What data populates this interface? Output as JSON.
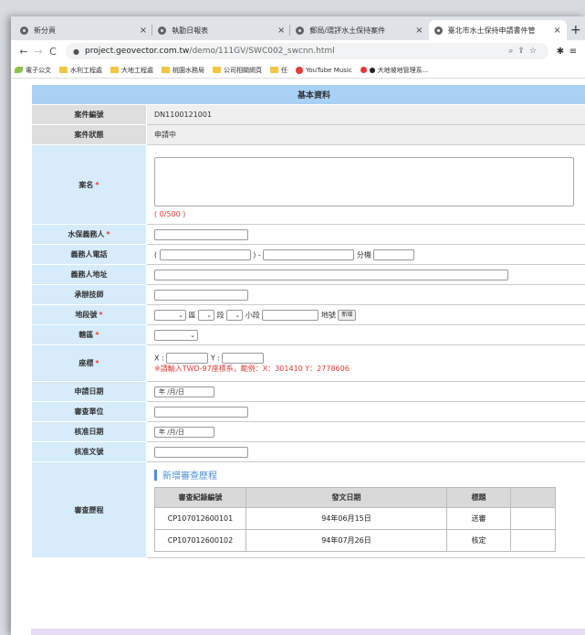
{
  "browser": {
    "tabs": [
      {
        "title": "新分頁",
        "active": false
      },
      {
        "title": "執勤日報表",
        "active": false
      },
      {
        "title": "郵局/環評水土保持案件",
        "active": false
      },
      {
        "title": "臺北市水土保持申請書件管",
        "active": true
      }
    ],
    "new_tab": "+",
    "url_host": "project.geovector.com.tw",
    "url_path": "/demo/111GV/SWC002_swcnn.html",
    "bookmarks": [
      "電子公文",
      "水利工程處",
      "大地工程處",
      "桃園水務局",
      "公司相關網頁",
      "任",
      "YouTube Music",
      "大地坡地管理系..."
    ]
  },
  "form": {
    "header": "基本資料",
    "case_no_label": "案件編號",
    "case_no_value": "DN1100121001",
    "status_label": "案件狀態",
    "status_value": "申請中",
    "name_label": "案名",
    "name_counter": "( 0/500 )",
    "obligor_label": "水保義務人",
    "phone_label": "義務人電話",
    "phone_open": "(",
    "phone_mid": ") -",
    "phone_ext": "分機",
    "address_label": "義務人地址",
    "tech_label": "承辦技師",
    "parcel_label": "地段號",
    "parcel_district": "區",
    "parcel_section": "段",
    "parcel_subsection": "小段",
    "parcel_number": "地號",
    "parcel_add": "新增",
    "jurisdiction_label": "轄區",
    "coord_label": "座標",
    "coord_x": "X :",
    "coord_y": "Y :",
    "coord_hint": "※請輸入TWD-97座標系，範例：X：301410 Y：2778606",
    "apply_date_label": "申請日期",
    "date_placeholder": "年 /月/日",
    "review_unit_label": "審查單位",
    "approve_date_label": "核准日期",
    "approve_doc_label": "核准文號",
    "history_label": "審查歷程",
    "history_add": "新增審查歷程",
    "history_columns": [
      "審查紀錄編號",
      "發文日期",
      "標題"
    ],
    "history_rows": [
      {
        "id": "CP107012600101",
        "date": "94年06月15日",
        "title": "送審"
      },
      {
        "id": "CP107012600102",
        "date": "94年07月26日",
        "title": "核定"
      }
    ]
  },
  "colors": {
    "header_bg": "#a9d0f5",
    "required": "#e53935",
    "label_gray": "#dedede",
    "label_blue": "#d6ebfb"
  }
}
